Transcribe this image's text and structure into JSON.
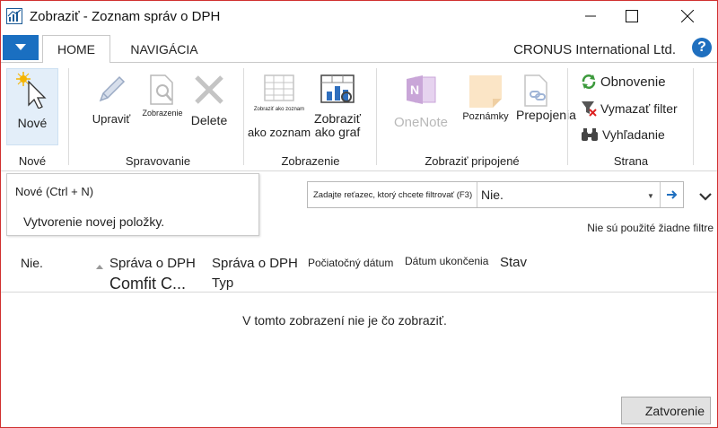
{
  "window": {
    "title": "Zobraziť - Zoznam správ o DPH"
  },
  "tabs": {
    "home": "HOME",
    "navigation": "NAVIGÁCIA"
  },
  "company": "CRONUS International Ltd.",
  "help": "?",
  "ribbon": {
    "groups": {
      "new": "Nové",
      "manage": "Spravovanie",
      "view": "Zobrazenie",
      "attached": "Zobraziť pripojené",
      "page": "Strana"
    },
    "buttons": {
      "new": "Nové",
      "edit": "Upraviť",
      "view": "Zobrazenie",
      "delete": "Delete",
      "show_as_list_small": "Zobraziť ako zoznam",
      "show_as_list": "ako zoznam",
      "show_as_chart_line1": "Zobraziť",
      "show_as_chart_line2": "ako graf",
      "onenote": "OneNote",
      "notes": "Poznámky",
      "links": "Prepojenia",
      "refresh": "Obnovenie",
      "clear_filter": "Vymazať filter",
      "find": "Vyhľadanie"
    }
  },
  "tooltip": {
    "title": "Nové (Ctrl + N)",
    "description": "Vytvorenie novej položky."
  },
  "filter": {
    "placeholder": "Zadajte reťazec, ktorý chcete filtrovať (F3)",
    "field": "Nie.",
    "status": "Nie sú použité žiadne filtre"
  },
  "columns": {
    "no": "Nie.",
    "vat_report": "Správa o DPH",
    "vat_report_value": "Comfit C...",
    "vat_report_type_line1": "Správa o DPH",
    "vat_report_type_line2": "Typ",
    "start_date": "Počiatočný dátum",
    "end_date": "Dátum ukončenia",
    "status": "Stav"
  },
  "empty_message": "V tomto zobrazení nie je čo zobraziť.",
  "close_button": "Zatvorenie",
  "colors": {
    "accent": "#1a6fc1",
    "window_border": "#d0302f",
    "onenote": "#c9a6d8"
  }
}
